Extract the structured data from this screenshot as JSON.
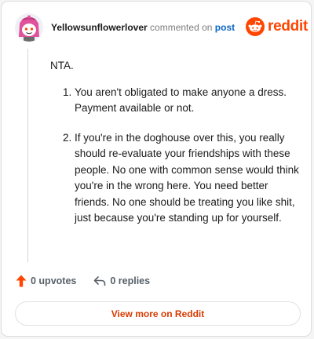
{
  "header": {
    "username": "Yellowsunflowerlover",
    "action_text": "commented on",
    "post_link": "post",
    "brand": "reddit"
  },
  "comment": {
    "intro": "NTA.",
    "points": [
      "You aren't obligated to make anyone a dress. Payment available or not.",
      "If you're in the doghouse over this, you really should re-evaluate your friendships with these people. No one with common sense would think you're in the wrong here. You need better friends. No one should be treating you like shit, just because you're standing up for yourself."
    ]
  },
  "actions": {
    "upvotes": "0 upvotes",
    "replies": "0 replies"
  },
  "footer": {
    "view_more": "View more on Reddit"
  },
  "colors": {
    "brand": "#ff4500",
    "upvote": "#ff4500",
    "link": "#0a66c2",
    "view_more": "#d93a00"
  },
  "icons": {
    "avatar": "snoo-avatar-pink-hair",
    "logo": "reddit-snoo-icon",
    "upvote": "arrow-up-icon",
    "reply": "reply-arrow-icon"
  }
}
